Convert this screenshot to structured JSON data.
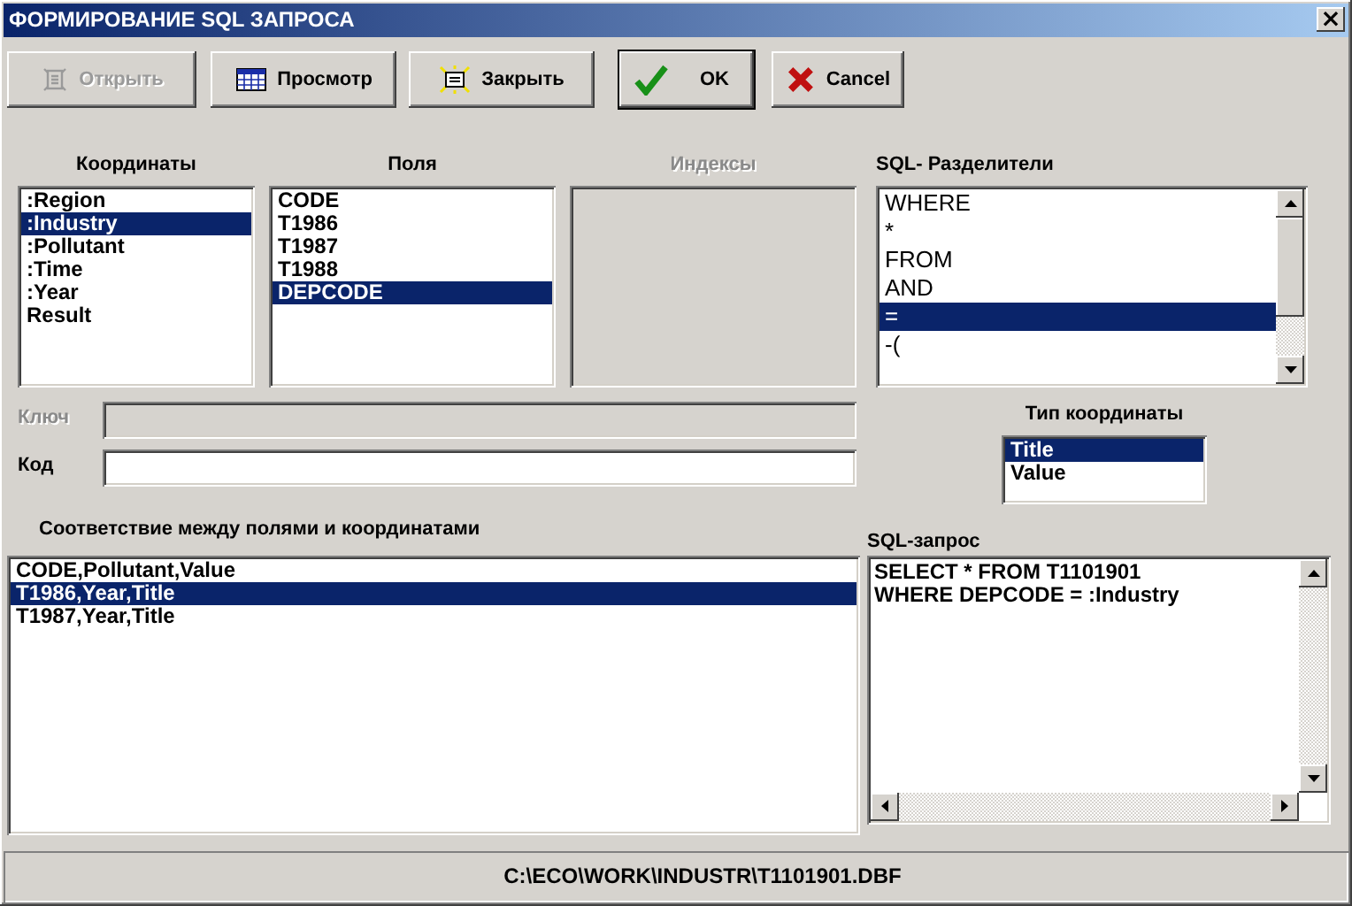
{
  "window": {
    "title": "ФОРМИРОВАНИЕ SQL ЗАПРОСА",
    "close": "×"
  },
  "toolbar": [
    {
      "kind": "open",
      "label": "Открыть",
      "disabled": true,
      "default": false
    },
    {
      "kind": "preview",
      "label": "Просмотр",
      "disabled": false,
      "default": false
    },
    {
      "kind": "close",
      "label": "Закрыть",
      "disabled": false,
      "default": false
    },
    {
      "kind": "ok",
      "label": "OK",
      "disabled": false,
      "default": true
    },
    {
      "kind": "cancel",
      "label": "Cancel",
      "disabled": false,
      "default": false
    }
  ],
  "coordinates": {
    "label": "Координаты",
    "items": [
      {
        "text": ":Region",
        "selected": false
      },
      {
        "text": ":Industry",
        "selected": true
      },
      {
        "text": ":Pollutant",
        "selected": false
      },
      {
        "text": ":Time",
        "selected": false
      },
      {
        "text": ":Year",
        "selected": false
      },
      {
        "text": "Result",
        "selected": false
      }
    ]
  },
  "fields": {
    "label": "Поля",
    "items": [
      {
        "text": "CODE",
        "selected": false
      },
      {
        "text": "T1986",
        "selected": false
      },
      {
        "text": "T1987",
        "selected": false
      },
      {
        "text": "T1988",
        "selected": false
      },
      {
        "text": "DEPCODE",
        "selected": true
      }
    ]
  },
  "indexes": {
    "label": "Индексы",
    "disabled": true
  },
  "sql_separators": {
    "label": "SQL- Разделители",
    "items": [
      {
        "text": "WHERE",
        "selected": false
      },
      {
        "text": "*",
        "selected": false
      },
      {
        "text": "FROM",
        "selected": false
      },
      {
        "text": "AND",
        "selected": false
      },
      {
        "text": "=",
        "selected": true
      },
      {
        "text": "-(",
        "selected": false
      }
    ]
  },
  "key": {
    "label": "Ключ",
    "disabled": true
  },
  "code": {
    "label": "Код",
    "disabled": false
  },
  "coordinate_type": {
    "label": "Тип координаты",
    "items": [
      {
        "text": "Title",
        "selected": true
      },
      {
        "text": "Value",
        "selected": false
      }
    ]
  },
  "mapping": {
    "label": "Соответствие между полями и координатами",
    "items": [
      {
        "text": "CODE,Pollutant,Value",
        "selected": false
      },
      {
        "text": "T1986,Year,Title",
        "selected": true
      },
      {
        "text": "T1987,Year,Title",
        "selected": false
      }
    ]
  },
  "sql_query": {
    "label": "SQL-запрос",
    "lines": [
      "SELECT * FROM T1101901",
      "WHERE DEPCODE = :Industry"
    ]
  },
  "status_bar": {
    "path": "C:\\ECO\\WORK\\INDUSTR\\T1101901.DBF"
  }
}
